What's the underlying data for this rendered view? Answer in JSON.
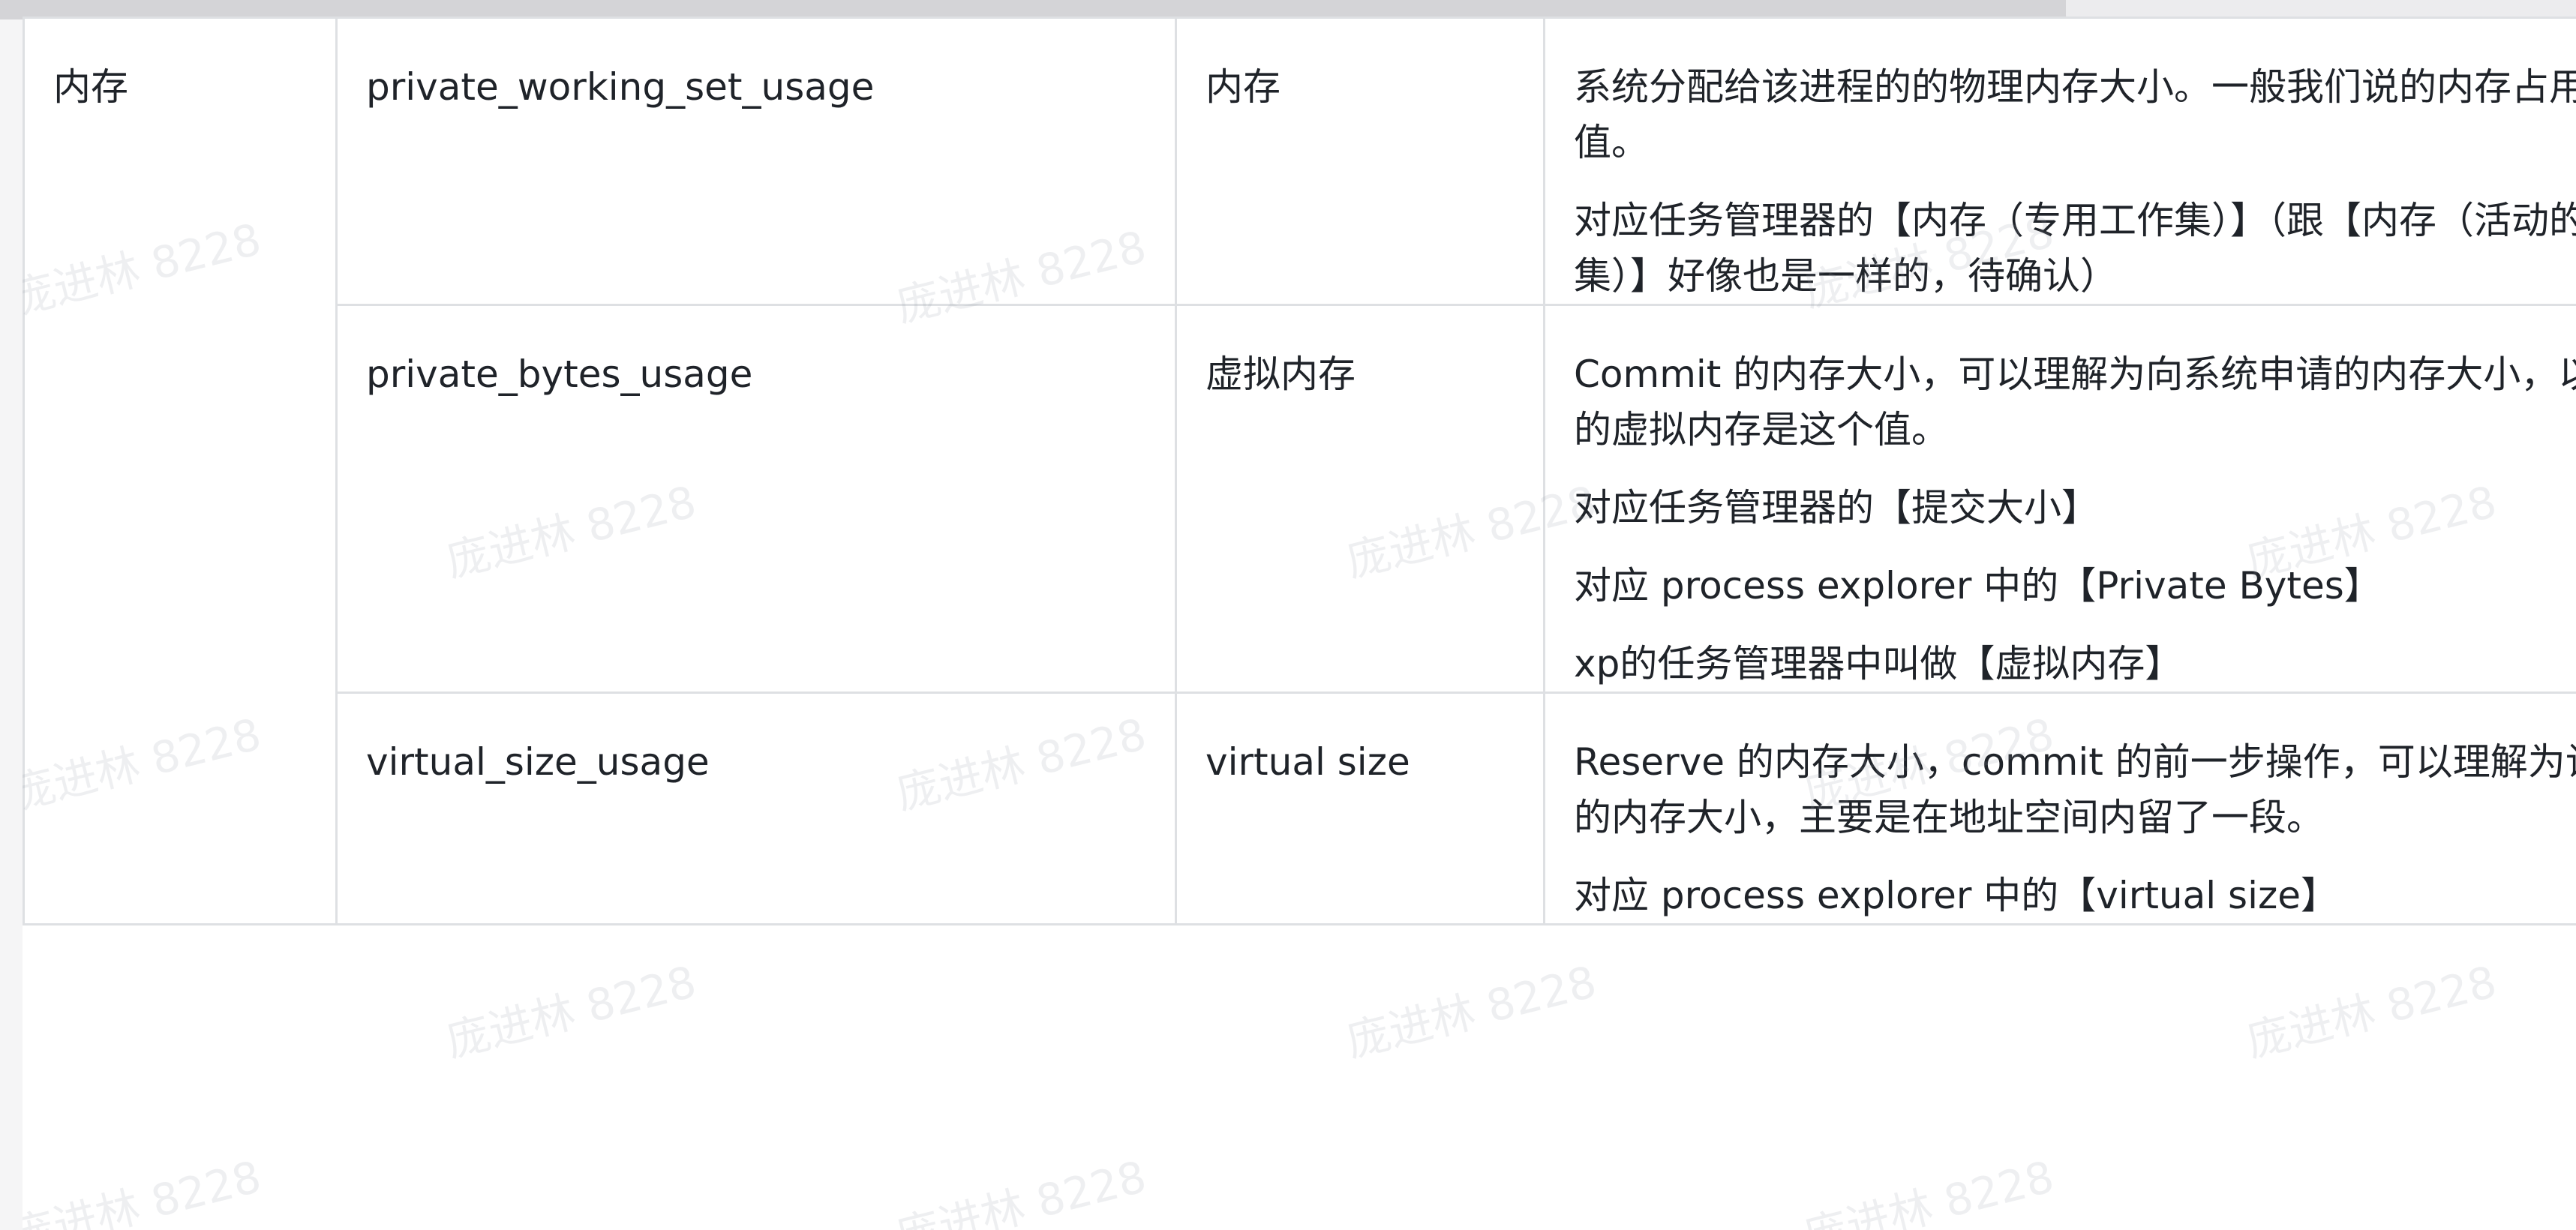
{
  "table": {
    "category": "内存",
    "rows": [
      {
        "key": "private_working_set_usage",
        "name": "内存",
        "desc": [
          "系统分配给该进程的的物理内存大小。一般我们说的内存占用是这个值。",
          "对应任务管理器的【内存（专用工作集）】（跟【内存（活动的专用工作集）】好像也是一样的，待确认）"
        ]
      },
      {
        "key": "private_bytes_usage",
        "name": "虚拟内存",
        "desc": [
          "Commit 的内存大小，可以理解为向系统申请的内存大小，以往我们说的虚拟内存是这个值。",
          "对应任务管理器的【提交大小】",
          "对应 process explorer 中的【Private Bytes】",
          "xp的任务管理器中叫做【虚拟内存】"
        ]
      },
      {
        "key": "virtual_size_usage",
        "name": "virtual size",
        "desc": [
          "Reserve 的内存大小，commit 的前一步操作，可以理解为让系统保留的内存大小，主要是在地址空间内留了一段。",
          "对应 process explorer 中的【virtual size】"
        ]
      }
    ]
  },
  "watermark_text": "庞进林 8228"
}
